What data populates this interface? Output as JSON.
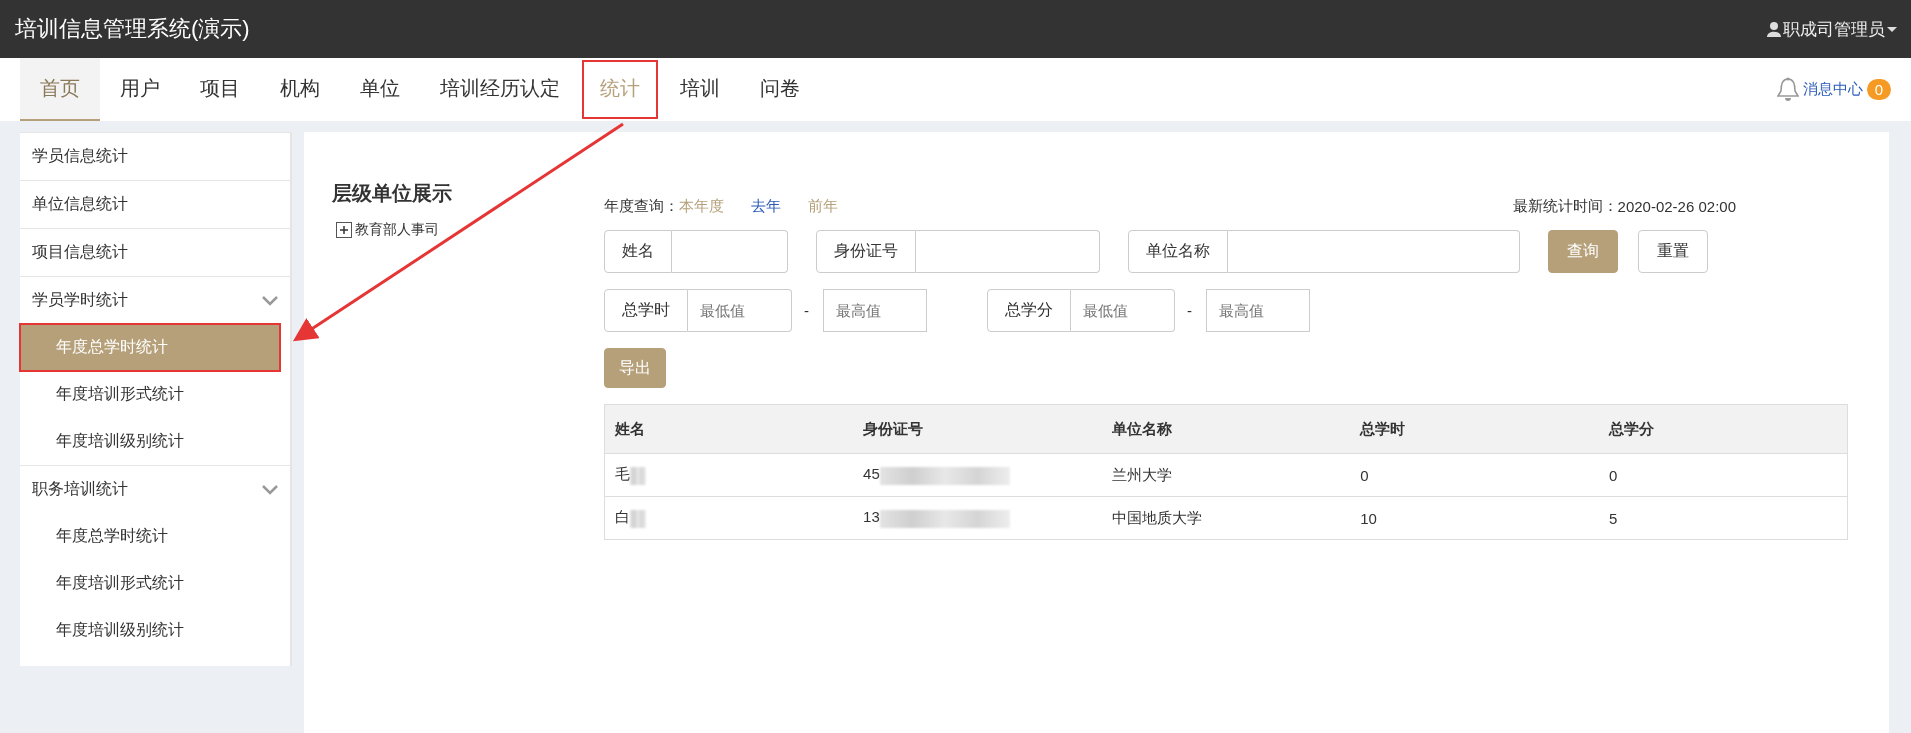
{
  "app": {
    "title": "培训信息管理系统(演示)",
    "user": "职成司管理员"
  },
  "nav": {
    "tabs": [
      {
        "label": "首页",
        "selected": true,
        "annotated": false
      },
      {
        "label": "用户",
        "selected": false,
        "annotated": false
      },
      {
        "label": "项目",
        "selected": false,
        "annotated": false
      },
      {
        "label": "机构",
        "selected": false,
        "annotated": false
      },
      {
        "label": "单位",
        "selected": false,
        "annotated": false
      },
      {
        "label": "培训经历认定",
        "selected": false,
        "annotated": false
      },
      {
        "label": "统计",
        "selected": false,
        "annotated": true
      },
      {
        "label": "培训",
        "selected": false,
        "annotated": false
      },
      {
        "label": "问卷",
        "selected": false,
        "annotated": false
      }
    ],
    "messages": {
      "label": "消息中心",
      "count": "0"
    }
  },
  "sidebar": {
    "items": [
      {
        "kind": "link",
        "label": "学员信息统计",
        "selected": false
      },
      {
        "kind": "link",
        "label": "单位信息统计",
        "selected": false
      },
      {
        "kind": "link",
        "label": "项目信息统计",
        "selected": false
      },
      {
        "kind": "group",
        "label": "学员学时统计",
        "selected": false,
        "expanded": true,
        "children": [
          {
            "label": "年度总学时统计",
            "selected": true,
            "annotated": true
          },
          {
            "label": "年度培训形式统计",
            "selected": false,
            "annotated": false
          },
          {
            "label": "年度培训级别统计",
            "selected": false,
            "annotated": false
          }
        ]
      },
      {
        "kind": "group",
        "label": "职务培训统计",
        "selected": false,
        "expanded": true,
        "children": [
          {
            "label": "年度总学时统计",
            "selected": false,
            "annotated": false
          },
          {
            "label": "年度培训形式统计",
            "selected": false,
            "annotated": false
          },
          {
            "label": "年度培训级别统计",
            "selected": false,
            "annotated": false
          }
        ]
      }
    ]
  },
  "tree": {
    "title": "层级单位展示",
    "nodes": [
      {
        "label": "教育部人事司",
        "expanded": false
      }
    ]
  },
  "year_filter": {
    "label": "年度查询：",
    "options": [
      {
        "label": "本年度",
        "selected": false
      },
      {
        "label": "去年",
        "selected": true
      },
      {
        "label": "前年",
        "selected": false
      }
    ]
  },
  "last_updated": {
    "label": "最新统计时间：",
    "value": "2020-02-26 02:00"
  },
  "search_fields": [
    {
      "label": "姓名"
    },
    {
      "label": "身份证号"
    },
    {
      "label": "单位名称"
    }
  ],
  "search_buttons": [
    {
      "label": "查询",
      "kind": "primary"
    },
    {
      "label": "重置",
      "kind": "default"
    }
  ],
  "range_fields": [
    {
      "label": "总学时",
      "min_placeholder": "最低值",
      "separator": "-",
      "max_placeholder": "最高值"
    },
    {
      "label": "总学分",
      "min_placeholder": "最低值",
      "separator": "-",
      "max_placeholder": "最高值"
    }
  ],
  "export_button": "导出",
  "table": {
    "columns": [
      "姓名",
      "身份证号",
      "单位名称",
      "总学时",
      "总学分"
    ],
    "rows": [
      {
        "cells": [
          "毛",
          "45",
          "兰州大学",
          "0",
          "0"
        ],
        "redacted": [
          true,
          true,
          false,
          false,
          false
        ]
      },
      {
        "cells": [
          "白",
          "13",
          "中国地质大学",
          "10",
          "5"
        ],
        "redacted": [
          true,
          true,
          false,
          false,
          false
        ]
      }
    ]
  }
}
